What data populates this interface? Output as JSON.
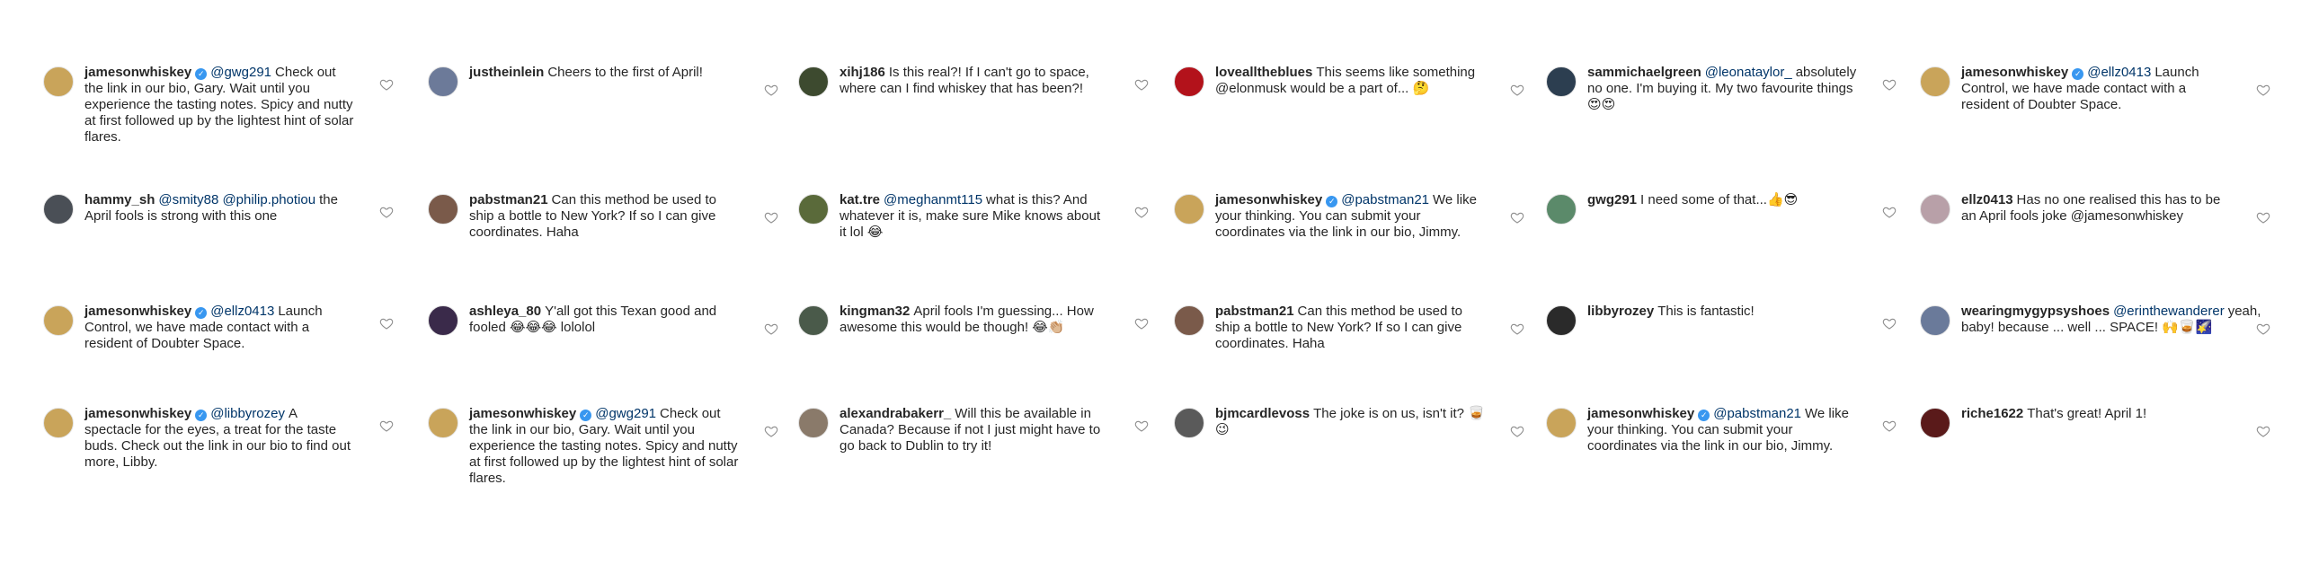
{
  "palette": {
    "text": "#262626",
    "mention": "#003569",
    "verified": "#3897f0",
    "heart_stroke": "#8e8e8e"
  },
  "comments": [
    {
      "user": "jamesonwhiskey",
      "verified": true,
      "mention": "@gwg291",
      "text": "Check out the link in our bio, Gary. Wait until you experience the tasting notes. Spicy and nutty at first followed up by the lightest hint of solar flares.",
      "avatar": "#c9a45a"
    },
    {
      "user": "justheinlein",
      "verified": false,
      "mention": "",
      "text": "Cheers to the first of April!",
      "avatar": "#6c7a99"
    },
    {
      "user": "xihj186",
      "verified": false,
      "mention": "",
      "text": "Is this real?! If I can't go to space, where can I find whiskey that has been?!",
      "avatar": "#3d4a2f"
    },
    {
      "user": "lovealltheblues",
      "verified": false,
      "mention": "",
      "text": "This seems like something @elonmusk would be a part of... 🤔",
      "avatar": "#b3121b"
    },
    {
      "user": "sammichaelgreen",
      "verified": false,
      "mention": "@leonataylor_",
      "text": "absolutely no one. I'm buying it. My two favourite things 😍😍",
      "avatar": "#2c3e50"
    },
    {
      "user": "jamesonwhiskey",
      "verified": true,
      "mention": "@ellz0413",
      "text": "Launch Control, we have made contact with a resident of Doubter Space.",
      "avatar": "#c9a45a"
    },
    {
      "user": "hammy_sh",
      "verified": false,
      "mention": "@smity88 @philip.photiou",
      "text": "the April fools is strong with this one",
      "avatar": "#4a4f56"
    },
    {
      "user": "pabstman21",
      "verified": false,
      "mention": "",
      "text": "Can this method be used to ship a bottle to New York? If so I can give coordinates. Haha",
      "avatar": "#7a5a4a"
    },
    {
      "user": "kat.tre",
      "verified": false,
      "mention": "@meghanmt115",
      "text": "what is this? And whatever it is, make sure Mike knows about it lol 😂",
      "avatar": "#5a6a3a"
    },
    {
      "user": "jamesonwhiskey",
      "verified": true,
      "mention": "@pabstman21",
      "text": "We like your thinking. You can submit your coordinates via the link in our bio, Jimmy.",
      "avatar": "#c9a45a"
    },
    {
      "user": "gwg291",
      "verified": false,
      "mention": "",
      "text": "I need some of that...👍😎",
      "avatar": "#5b8a6a"
    },
    {
      "user": "ellz0413",
      "verified": false,
      "mention": "",
      "text": "Has no one realised this has to be an April fools joke @jamesonwhiskey",
      "avatar": "#b8a0a8"
    },
    {
      "user": "jamesonwhiskey",
      "verified": true,
      "mention": "@ellz0413",
      "text": "Launch Control, we have made contact with a resident of Doubter Space.",
      "avatar": "#c9a45a"
    },
    {
      "user": "ashleya_80",
      "verified": false,
      "mention": "",
      "text": "Y'all got this Texan good and fooled 😂😂😂 lololol",
      "avatar": "#3a2a4a"
    },
    {
      "user": "kingman32",
      "verified": false,
      "mention": "",
      "text": "April fools I'm guessing... How awesome this would be though! 😂👏🏼",
      "avatar": "#4a5a4a"
    },
    {
      "user": "pabstman21",
      "verified": false,
      "mention": "",
      "text": "Can this method be used to ship a bottle to New York? If so I can give coordinates. Haha",
      "avatar": "#7a5a4a"
    },
    {
      "user": "libbyrozey",
      "verified": false,
      "mention": "",
      "text": "This is fantastic!",
      "avatar": "#2a2a2a"
    },
    {
      "user": "wearingmygypsyshoes",
      "verified": false,
      "mention": "@erinthewanderer",
      "text": "yeah, baby! because ... well ... SPACE! 🙌🥃🌠",
      "avatar": "#6a7a9a"
    },
    {
      "user": "jamesonwhiskey",
      "verified": true,
      "mention": "@libbyrozey",
      "text": "A spectacle for the eyes, a treat for the taste buds. Check out the link in our bio to find out more, Libby.",
      "avatar": "#c9a45a"
    },
    {
      "user": "jamesonwhiskey",
      "verified": true,
      "mention": "@gwg291",
      "text": "Check out the link in our bio, Gary. Wait until you experience the tasting notes. Spicy and nutty at first followed up by the lightest hint of solar flares.",
      "avatar": "#c9a45a"
    },
    {
      "user": "alexandrabakerr_",
      "verified": false,
      "mention": "",
      "text": "Will this be available in Canada? Because if not I just might have to go back to Dublin to try it!",
      "avatar": "#8a7a6a"
    },
    {
      "user": "bjmcardlevoss",
      "verified": false,
      "mention": "",
      "text": "The joke is on us, isn't it? 🥃😉",
      "avatar": "#5a5a5a"
    },
    {
      "user": "jamesonwhiskey",
      "verified": true,
      "mention": "@pabstman21",
      "text": "We like your thinking. You can submit your coordinates via the link in our bio, Jimmy.",
      "avatar": "#c9a45a"
    },
    {
      "user": "riche1622",
      "verified": false,
      "mention": "",
      "text": "That's great!  April 1!",
      "avatar": "#5a1a1a"
    }
  ]
}
